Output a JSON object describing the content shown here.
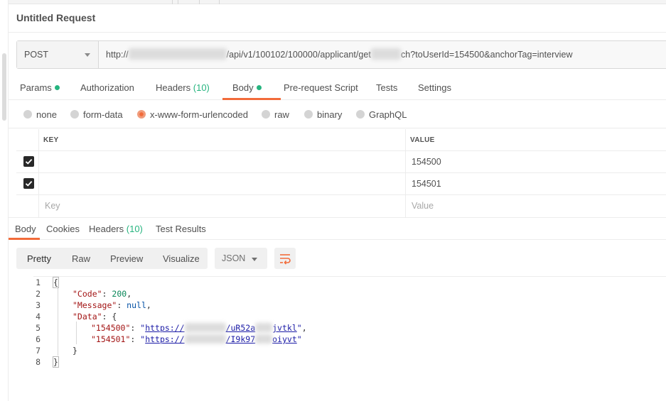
{
  "request": {
    "title": "Untitled Request",
    "method": "POST",
    "url_prefix": "http://",
    "url_middle": "/api/v1/100102/100000/applicant/get",
    "url_suffix": "ch?toUserId=154500&anchorTag=interview"
  },
  "request_tabs": {
    "params": "Params",
    "authorization": "Authorization",
    "headers": "Headers",
    "headers_count": "(10)",
    "body": "Body",
    "pre_request_script": "Pre-request Script",
    "tests": "Tests",
    "settings": "Settings"
  },
  "body_types": {
    "none": "none",
    "form_data": "form-data",
    "x_www_form_urlencoded": "x-www-form-urlencoded",
    "raw": "raw",
    "binary": "binary",
    "graphql": "GraphQL"
  },
  "kv_table": {
    "header_key": "KEY",
    "header_value": "VALUE",
    "rows": [
      {
        "key": "",
        "value": "154500"
      },
      {
        "key": "",
        "value": "154501"
      }
    ],
    "placeholder_key": "Key",
    "placeholder_value": "Value"
  },
  "response_tabs": {
    "body": "Body",
    "cookies": "Cookies",
    "headers": "Headers",
    "headers_count": "(10)",
    "test_results": "Test Results"
  },
  "response_view": {
    "pretty": "Pretty",
    "raw": "Raw",
    "preview": "Preview",
    "visualize": "Visualize",
    "format": "JSON"
  },
  "response_code": {
    "line_numbers": [
      "1",
      "2",
      "3",
      "4",
      "5",
      "6",
      "7",
      "8"
    ],
    "open_brace": "{",
    "code_key": "\"Code\"",
    "code_value": "200",
    "message_key": "\"Message\"",
    "message_value": "null",
    "data_key": "\"Data\"",
    "data_open": "{",
    "item1_key": "\"154500\"",
    "item1_link_start": "https://",
    "item1_link_end": "/uR52a",
    "item1_link_tail": "jvtkl",
    "item2_key": "\"154501\"",
    "item2_link_start": "https://",
    "item2_link_end": "/I9k97",
    "item2_link_tail": "oiyvt",
    "data_close": "}",
    "close_brace": "}"
  },
  "icons": {
    "method_dropdown": "chevron-down-icon",
    "format_dropdown": "chevron-down-icon",
    "wrap": "wrap-lines-icon",
    "checkbox": "check-icon"
  },
  "colors": {
    "accent": "#f26b3a",
    "status_green": "#26b47f"
  }
}
